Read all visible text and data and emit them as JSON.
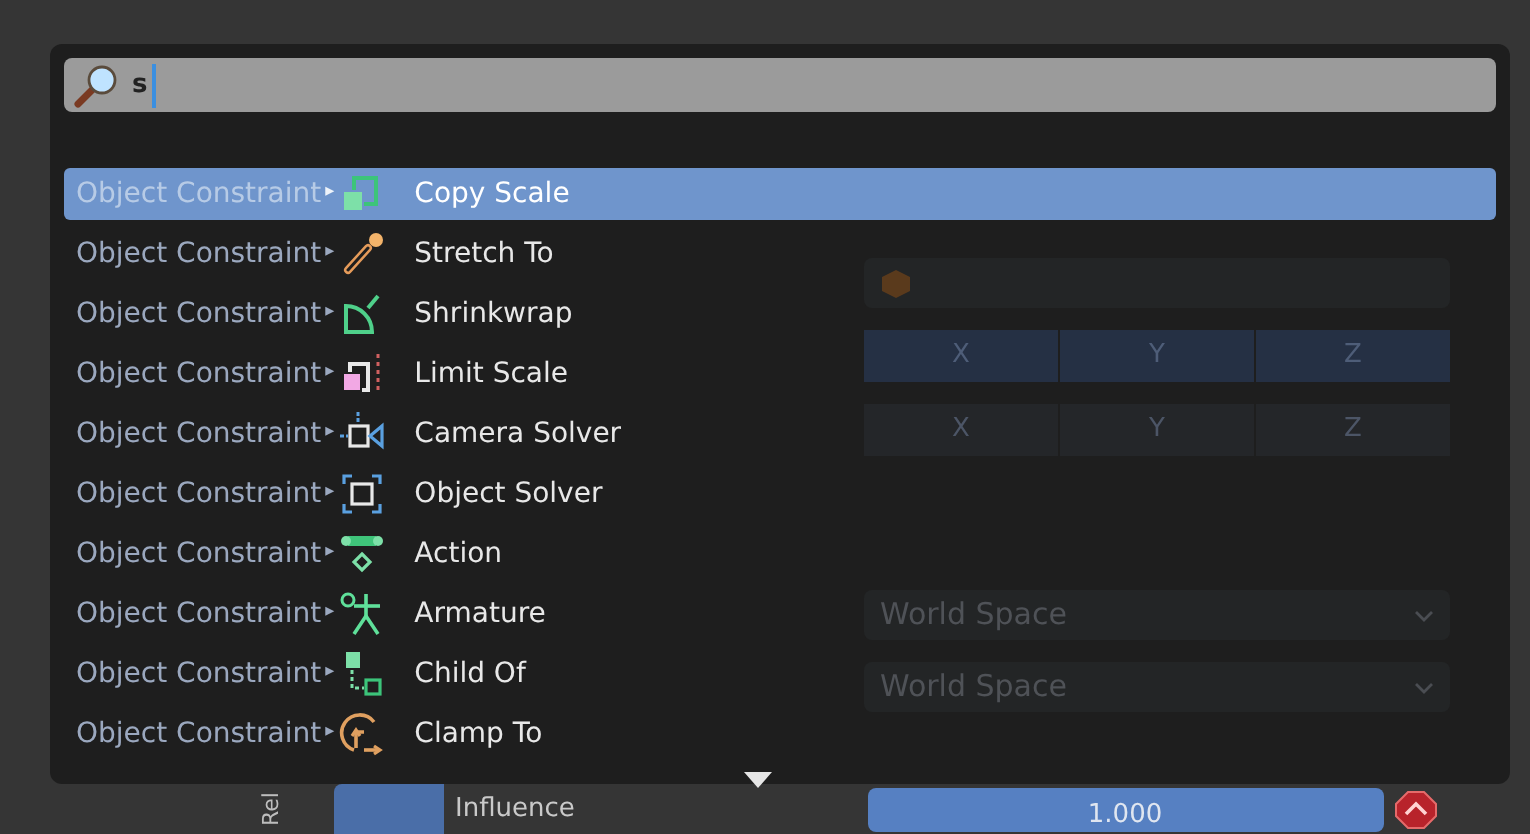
{
  "search": {
    "value": "s"
  },
  "results": [
    {
      "category": "Object Constraint",
      "separator": "▸",
      "name": "Copy Scale",
      "selected": true
    },
    {
      "category": "Object Constraint",
      "separator": "▸",
      "name": "Stretch To",
      "selected": false
    },
    {
      "category": "Object Constraint",
      "separator": "▸",
      "name": "Shrinkwrap",
      "selected": false
    },
    {
      "category": "Object Constraint",
      "separator": "▸",
      "name": "Limit Scale",
      "selected": false
    },
    {
      "category": "Object Constraint",
      "separator": "▸",
      "name": "Camera Solver",
      "selected": false
    },
    {
      "category": "Object Constraint",
      "separator": "▸",
      "name": "Object Solver",
      "selected": false
    },
    {
      "category": "Object Constraint",
      "separator": "▸",
      "name": "Action",
      "selected": false
    },
    {
      "category": "Object Constraint",
      "separator": "▸",
      "name": "Armature",
      "selected": false
    },
    {
      "category": "Object Constraint",
      "separator": "▸",
      "name": "Child Of",
      "selected": false
    },
    {
      "category": "Object Constraint",
      "separator": "▸",
      "name": "Clamp To",
      "selected": false
    }
  ],
  "background_panel": {
    "axis_rows": [
      [
        {
          "label": "X",
          "on": true
        },
        {
          "label": "Y",
          "on": true
        },
        {
          "label": "Z",
          "on": true
        }
      ],
      [
        {
          "label": "X",
          "on": false
        },
        {
          "label": "Y",
          "on": false
        },
        {
          "label": "Z",
          "on": false
        }
      ]
    ],
    "space_fields": [
      "World Space",
      "World Space"
    ],
    "tab": "Rel",
    "influence": {
      "label": "Influence",
      "value": "1.000",
      "level": 1
    }
  }
}
